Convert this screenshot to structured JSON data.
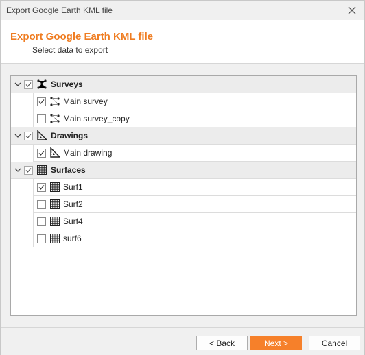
{
  "window": {
    "title": "Export Google Earth KML file"
  },
  "header": {
    "heading": "Export Google Earth KML file",
    "subheading": "Select data to export",
    "accent_color": "#ef7d22"
  },
  "tree": {
    "groups": [
      {
        "label": "Surveys",
        "icon": "survey-points-icon",
        "checked": true,
        "expanded": true,
        "items": [
          {
            "label": "Main survey",
            "icon": "survey-icon",
            "checked": true
          },
          {
            "label": "Main survey_copy",
            "icon": "survey-icon",
            "checked": false
          }
        ]
      },
      {
        "label": "Drawings",
        "icon": "drawing-icon",
        "checked": true,
        "expanded": true,
        "items": [
          {
            "label": "Main drawing",
            "icon": "drawing-icon",
            "checked": true
          }
        ]
      },
      {
        "label": "Surfaces",
        "icon": "grid-icon",
        "checked": true,
        "expanded": true,
        "items": [
          {
            "label": "Surf1",
            "icon": "grid-icon",
            "checked": true
          },
          {
            "label": "Surf2",
            "icon": "grid-icon",
            "checked": false
          },
          {
            "label": "Surf4",
            "icon": "grid-icon",
            "checked": false
          },
          {
            "label": "surf6",
            "icon": "grid-icon",
            "checked": false
          }
        ]
      }
    ]
  },
  "footer": {
    "back_label": "< Back",
    "next_label": "Next >",
    "cancel_label": "Cancel",
    "primary_color": "#f6802a"
  }
}
